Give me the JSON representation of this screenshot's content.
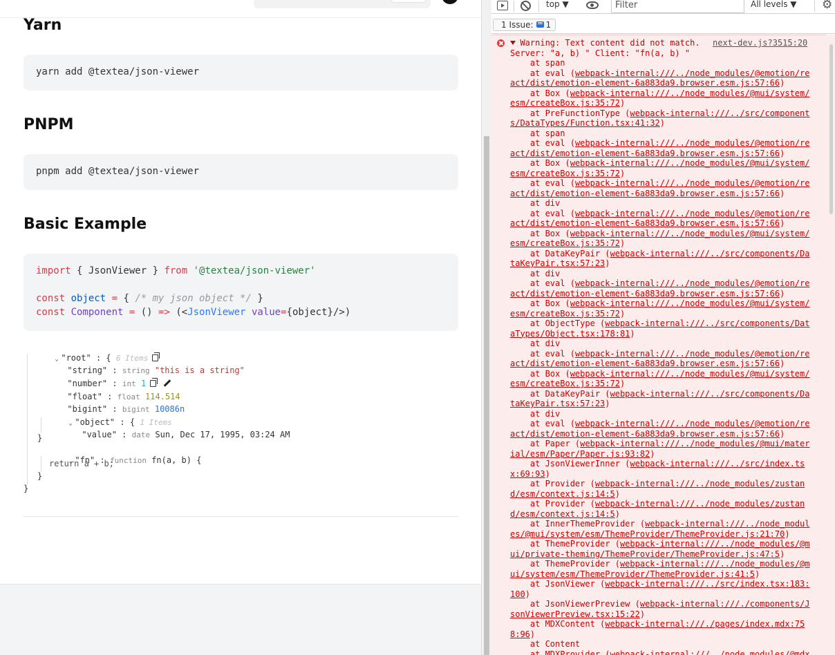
{
  "docs": {
    "yarn_heading": "Yarn",
    "yarn_command": "yarn add @textea/json-viewer",
    "pnpm_heading": "PNPM",
    "pnpm_command": "pnpm add @textea/json-viewer",
    "basic_heading": "Basic Example",
    "code": {
      "l1_import": "import",
      "l1_brace_open": " { JsonViewer } ",
      "l1_from": "from",
      "l1_module": "'@textea/json-viewer'",
      "l2_const": "const",
      "l2_name": "object",
      "l2_eq": "=",
      "l2_brace_open": " { ",
      "l2_comment": "/* my json object */",
      "l2_brace_close": " }",
      "l3_const": "const",
      "l3_name": "Component",
      "l3_eq": "=",
      "l3_parens": " () ",
      "l3_arrow": "=>",
      "l3_open": " (<",
      "l3_tag": "JsonViewer",
      "l3_attr": "value",
      "l3_eq2": "=",
      "l3_rest": "{object}/>)"
    }
  },
  "json_viewer": {
    "root_key": "\"root\"",
    "root_open": "{",
    "root_count": "6 Items",
    "string_key": "\"string\"",
    "string_type": "string",
    "string_value": "\"this is a string\"",
    "number_key": "\"number\"",
    "number_type": "int",
    "number_value": "1",
    "float_key": "\"float\"",
    "float_type": "float",
    "float_value": "114.514",
    "bigint_key": "\"bigint\"",
    "bigint_type": "bigint",
    "bigint_value": "10086n",
    "object_key": "\"object\"",
    "object_open": "{",
    "object_count": "1 Items",
    "value_key": "\"value\"",
    "value_type": "date",
    "value_value": "Sun, Dec 17, 1995, 03:24 AM",
    "object_close": "}",
    "fn_key": "\"fn\"",
    "fn_type": "function",
    "fn_signature": "fn(a, b) {",
    "fn_body": "return a + b;",
    "fn_close": "}",
    "root_close": "}",
    "colon": ":"
  },
  "devtools": {
    "context": "top ▼",
    "filter_placeholder": "Filter",
    "levels": "All levels ▼",
    "issues_label": "1 Issue:",
    "issues_count": "1",
    "source_link": "next-dev.js?3515:20",
    "warning_title": "Warning: Text content did not match.",
    "warning_detail": "Server: \"a, b) \" Client: \"fn(a, b) \"",
    "stack": [
      {
        "fn": "span",
        "loc": ""
      },
      {
        "fn": "eval",
        "loc": "webpack-internal:///../node_modules/@emotion/react/dist/emotion-element-6a883da9.browser.esm.js:57:66"
      },
      {
        "fn": "Box",
        "loc": "webpack-internal:///../node_modules/@mui/system/esm/createBox.js:35:72"
      },
      {
        "fn": "PreFunctionType",
        "loc": "webpack-internal:///../src/components/DataTypes/Function.tsx:41:32"
      },
      {
        "fn": "span",
        "loc": ""
      },
      {
        "fn": "eval",
        "loc": "webpack-internal:///../node_modules/@emotion/react/dist/emotion-element-6a883da9.browser.esm.js:57:66"
      },
      {
        "fn": "Box",
        "loc": "webpack-internal:///../node_modules/@mui/system/esm/createBox.js:35:72"
      },
      {
        "fn": "eval",
        "loc": "webpack-internal:///../node_modules/@emotion/react/dist/emotion-element-6a883da9.browser.esm.js:57:66"
      },
      {
        "fn": "div",
        "loc": ""
      },
      {
        "fn": "eval",
        "loc": "webpack-internal:///../node_modules/@emotion/react/dist/emotion-element-6a883da9.browser.esm.js:57:66"
      },
      {
        "fn": "Box",
        "loc": "webpack-internal:///../node_modules/@mui/system/esm/createBox.js:35:72"
      },
      {
        "fn": "DataKeyPair",
        "loc": "webpack-internal:///../src/components/DataKeyPair.tsx:57:23"
      },
      {
        "fn": "div",
        "loc": ""
      },
      {
        "fn": "eval",
        "loc": "webpack-internal:///../node_modules/@emotion/react/dist/emotion-element-6a883da9.browser.esm.js:57:66"
      },
      {
        "fn": "Box",
        "loc": "webpack-internal:///../node_modules/@mui/system/esm/createBox.js:35:72"
      },
      {
        "fn": "ObjectType",
        "loc": "webpack-internal:///../src/components/DataTypes/Object.tsx:178:81"
      },
      {
        "fn": "div",
        "loc": ""
      },
      {
        "fn": "eval",
        "loc": "webpack-internal:///../node_modules/@emotion/react/dist/emotion-element-6a883da9.browser.esm.js:57:66"
      },
      {
        "fn": "Box",
        "loc": "webpack-internal:///../node_modules/@mui/system/esm/createBox.js:35:72"
      },
      {
        "fn": "DataKeyPair",
        "loc": "webpack-internal:///../src/components/DataKeyPair.tsx:57:23"
      },
      {
        "fn": "div",
        "loc": ""
      },
      {
        "fn": "eval",
        "loc": "webpack-internal:///../node_modules/@emotion/react/dist/emotion-element-6a883da9.browser.esm.js:57:66"
      },
      {
        "fn": "Paper",
        "loc": "webpack-internal:///../node_modules/@mui/material/esm/Paper/Paper.js:93:82"
      },
      {
        "fn": "JsonViewerInner",
        "loc": "webpack-internal:///../src/index.tsx:69:93"
      },
      {
        "fn": "Provider",
        "loc": "webpack-internal:///../node_modules/zustand/esm/context.js:14:5"
      },
      {
        "fn": "Provider",
        "loc": "webpack-internal:///../node_modules/zustand/esm/context.js:14:5"
      },
      {
        "fn": "InnerThemeProvider",
        "loc": "webpack-internal:///../node_modules/@mui/system/esm/ThemeProvider/ThemeProvider.js:21:70"
      },
      {
        "fn": "ThemeProvider",
        "loc": "webpack-internal:///../node_modules/@mui/private-theming/ThemeProvider/ThemeProvider.js:47:5"
      },
      {
        "fn": "ThemeProvider",
        "loc": "webpack-internal:///../node_modules/@mui/system/esm/ThemeProvider/ThemeProvider.js:41:5"
      },
      {
        "fn": "JsonViewer",
        "loc": "webpack-internal:///../src/index.tsx:183:100"
      },
      {
        "fn": "JsonViewerPreview",
        "loc": "webpack-internal:///./components/JsonViewerPreview.tsx:15:22"
      },
      {
        "fn": "MDXContent",
        "loc": "webpack-internal:///./pages/index.mdx:758:96"
      },
      {
        "fn": "Content",
        "loc": ""
      },
      {
        "fn": "MDXProvider",
        "loc": "webpack-internal:///../node_modules/@mdx-"
      }
    ]
  },
  "colors": {
    "console_error_bg": "#fcecec",
    "console_error_text": "#c00",
    "code_bg": "#f3f4f6",
    "accent": "#1a73e8"
  }
}
